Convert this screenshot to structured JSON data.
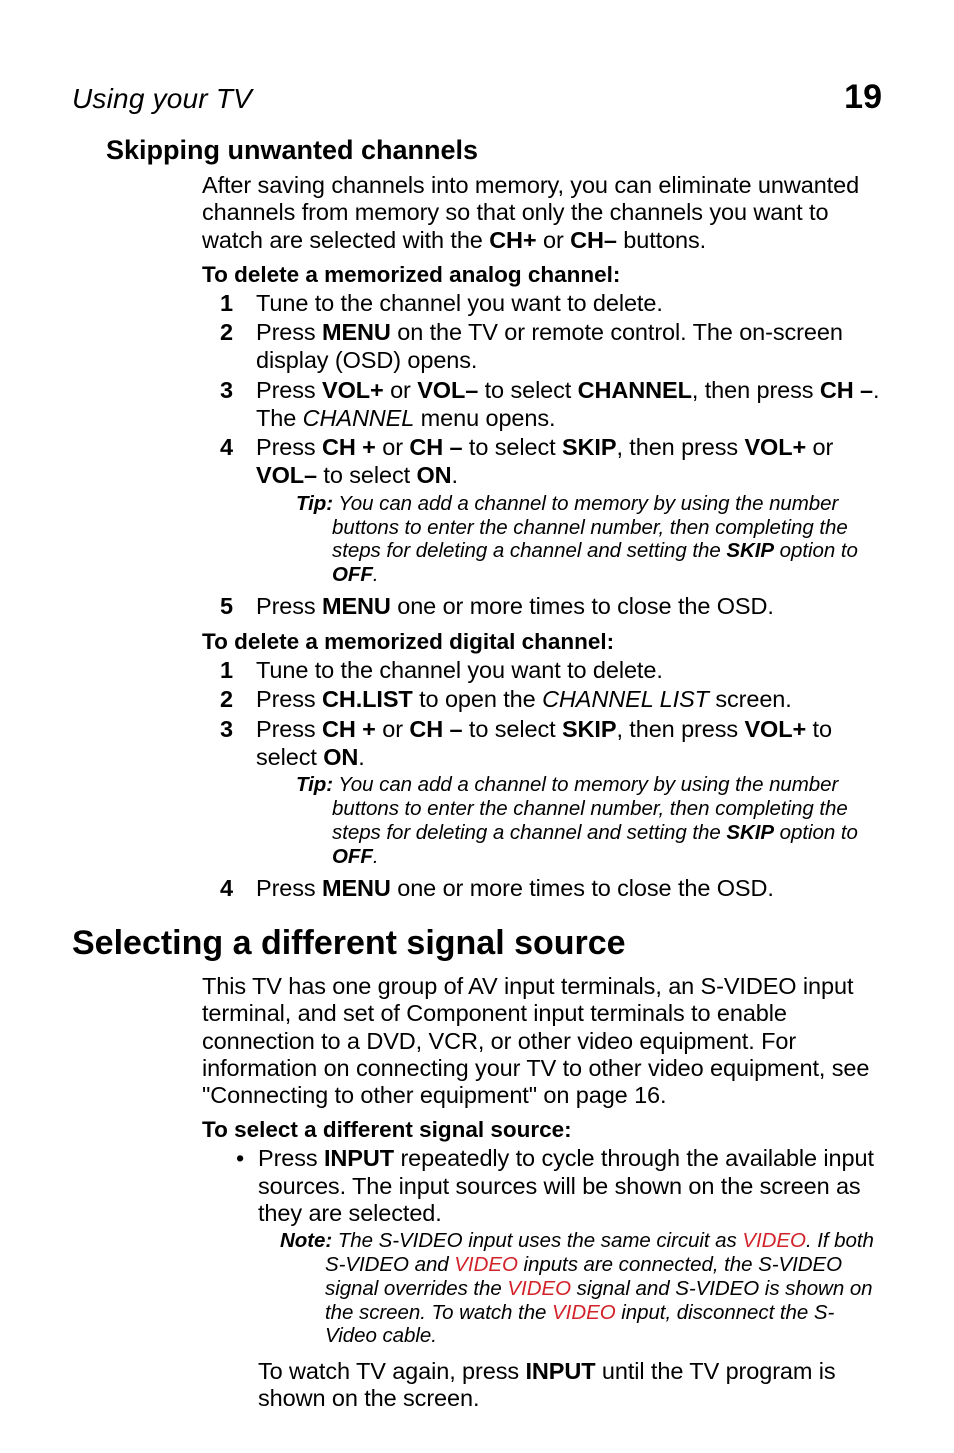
{
  "header": {
    "title": "Using your TV",
    "page_number": "19"
  },
  "section1": {
    "heading": "Skipping unwanted channels",
    "intro": "After saving channels into memory, you can eliminate unwanted channels from memory so that only the channels you want to watch are selected with the CH+ or CH– buttons.",
    "intro_pre": "After saving channels into memory, you can eliminate unwanted channels from memory so that only the channels you want to watch are selected with the ",
    "intro_ch_plus": "CH+",
    "intro_or": " or ",
    "intro_ch_minus": "CH–",
    "intro_post": " buttons.",
    "delete_analog": {
      "lead": "To delete a memorized analog channel:",
      "step1": "Tune to the channel you want to delete.",
      "step2_pre": "Press ",
      "step2_menu": "MENU",
      "step2_post": " on the TV or remote control. The on-screen display (OSD) opens.",
      "step3_pre": "Press ",
      "step3_volp": "VOL+",
      "step3_or1": " or ",
      "step3_volm": "VOL–",
      "step3_mid": " to select ",
      "step3_channel": "CHANNEL",
      "step3_then": ", then press ",
      "step3_chm": "CH –",
      "step3_dot": ". The ",
      "step3_italic": "CHANNEL",
      "step3_end": " menu opens.",
      "step4_pre": "Press ",
      "step4_chp": "CH +",
      "step4_or1": " or ",
      "step4_chm": "CH –",
      "step4_mid": " to select ",
      "step4_skip": "SKIP",
      "step4_then": ", then press ",
      "step4_volp": "VOL+",
      "step4_or2": " or ",
      "step4_volm": "VOL–",
      "step4_sel": " to select ",
      "step4_on": "ON",
      "step4_dot": ".",
      "tip_label": "Tip:",
      "tip_text_pre": " You can add a channel to memory by using the number buttons to enter the channel number, then completing the steps for deleting a channel and setting the ",
      "tip_skip": "SKIP",
      "tip_mid": " option to ",
      "tip_off": "OFF",
      "tip_end": ".",
      "step5_pre": "Press ",
      "step5_menu": "MENU",
      "step5_post": " one or more times to close the OSD."
    },
    "delete_digital": {
      "lead": "To delete a memorized digital channel:",
      "step1": "Tune to the channel you want to delete.",
      "step2_pre": "Press ",
      "step2_chlist": "CH.LIST",
      "step2_mid": " to open the ",
      "step2_italic": "CHANNEL LIST",
      "step2_end": " screen.",
      "step3_pre": "Press ",
      "step3_chp": "CH +",
      "step3_or1": " or ",
      "step3_chm": "CH –",
      "step3_mid": " to select ",
      "step3_skip": "SKIP",
      "step3_then": ", then press ",
      "step3_volp": "VOL+",
      "step3_sel": " to select ",
      "step3_on": "ON",
      "step3_dot": ".",
      "tip_label": "Tip:",
      "tip_text_pre": " You can add a channel to memory by using the number buttons to enter the channel number, then completing the steps for deleting a channel and setting the ",
      "tip_skip": "SKIP",
      "tip_mid": " option to ",
      "tip_off": "OFF",
      "tip_end": ".",
      "step4_pre": "Press ",
      "step4_menu": "MENU",
      "step4_post": " one or more times to close the OSD."
    }
  },
  "section2": {
    "heading": "Selecting a different signal source",
    "para": "This TV has one group of AV input terminals, an S-VIDEO input terminal, and set of Component input terminals to enable connection to a DVD, VCR, or other video equipment. For information on connecting your TV to other video equipment, see \"Connecting to other equipment\" on page 16.",
    "lead": "To select a different signal source:",
    "bullet_pre": "Press ",
    "bullet_input": "INPUT",
    "bullet_post": " repeatedly to cycle through the available input sources. The input sources will be shown on the screen as they are selected.",
    "note_label": "Note:",
    "note_pre": " The S-VIDEO input uses the same circuit as ",
    "note_v1": "VIDEO",
    "note_mid1": ". If both S-VIDEO and ",
    "note_v2": "VIDEO",
    "note_mid2": " inputs are connected, the S-VIDEO signal overrides the ",
    "note_v3": "VIDEO",
    "note_mid3": " signal and S-VIDEO is shown on the screen.  To watch the ",
    "note_v4": "VIDEO",
    "note_end": " input, disconnect the S-Video cable.",
    "after_pre": "To watch TV again, press ",
    "after_input": "INPUT",
    "after_post": " until the TV program is shown on the screen."
  }
}
